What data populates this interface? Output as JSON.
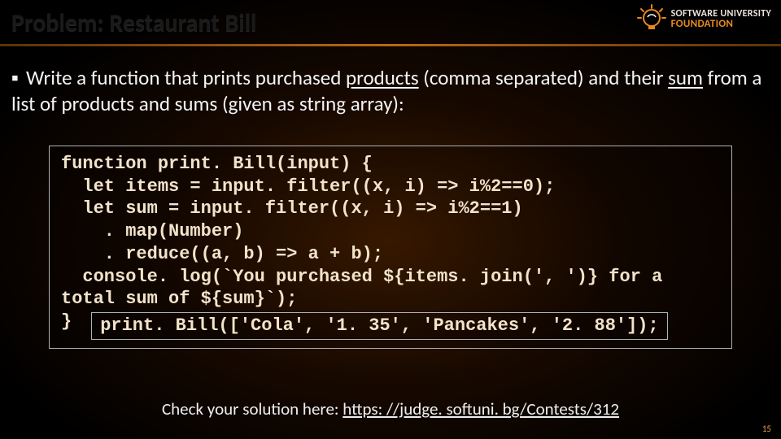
{
  "logo": {
    "line1": "SOFTWARE UNIVERSITY",
    "line2": "FOUNDATION"
  },
  "title": "Problem: Restaurant Bill",
  "bullet": {
    "prefix": "Write a function that prints purchased ",
    "products_word": "products",
    "mid1": " (comma separated) and their ",
    "sum_word": "sum",
    "suffix": " from a list of products and sums (given as string array):"
  },
  "code": {
    "l1": "function print. Bill(input) {",
    "l2": "  let items = input. filter((x, i) => i%2==0);",
    "l3": "  let sum = input. filter((x, i) => i%2==1)",
    "l4": "    . map(Number)",
    "l5": "    . reduce((a, b) => a + b);",
    "l6": "  console. log(`You purchased ${items. join(', ')} for a",
    "l7": "total sum of ${sum}`);",
    "l8_brace": "}",
    "call": "print. Bill(['Cola', '1. 35', 'Pancakes', '2. 88']);"
  },
  "check": {
    "prefix": "Check your solution here: ",
    "url": "https: //judge. softuni. bg/Contests/312"
  },
  "page_number": "15"
}
